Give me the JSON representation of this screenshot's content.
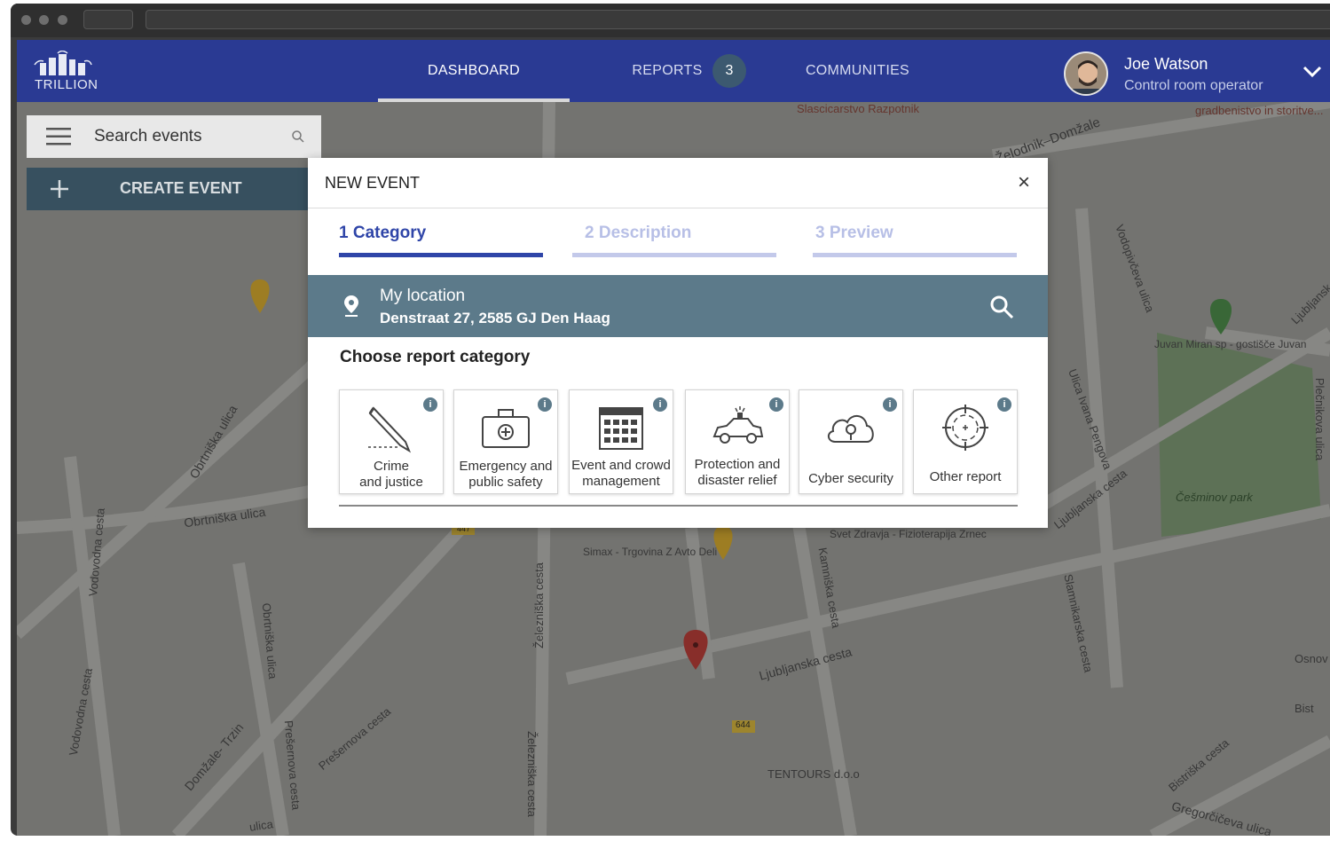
{
  "nav": {
    "logo_text": "TRILLION",
    "items": [
      {
        "label": "DASHBOARD"
      },
      {
        "label": "REPORTS"
      },
      {
        "label": "COMMUNITIES"
      }
    ],
    "reports_badge": "3"
  },
  "user": {
    "name": "Joe Watson",
    "role": "Control room operator"
  },
  "sidebar": {
    "search_placeholder": "Search events",
    "create_label": "CREATE EVENT"
  },
  "map": {
    "labels": [
      "Slascicarstvo Razpotnik",
      "Želodnik–Domžale",
      "gradbenistvo in storitve...",
      "Vodopivčeva ulica",
      "Juvan Miran sp - gostišče Juvan",
      "Plečnikova ulica",
      "Ljubljansk",
      "Ulica Ivana Pengova",
      "Ljubljanska cesta",
      "Češminov park",
      "Obrtniška ulica",
      "Obrtniška ulica",
      "Vodovodna cesta",
      "Vodovodna cesta",
      "Obrtniška ulica",
      "Simax - Trgovina Z Avto Deli",
      "Železniška cesta",
      "Železniška cesta",
      "Kamniška cesta",
      "Svet Zdravja - Fizioterapija Zrnec",
      "Slamnikarska cesta",
      "Ljubljanska cesta",
      "Osnov",
      "Bist",
      "Bistriška cesta",
      "Gregorčičeva ulica",
      "TENTOURS d.o.o",
      "Domžale- Trzin",
      "Prešernova cesta",
      "Prešernova cesta",
      "ulica"
    ],
    "road_numbers": [
      "644",
      "447"
    ]
  },
  "modal": {
    "title": "NEW EVENT",
    "close": "×",
    "steps": [
      {
        "label": "1 Category",
        "active": true
      },
      {
        "label": "2 Description",
        "active": false
      },
      {
        "label": "3 Preview",
        "active": false
      }
    ],
    "location_title": "My location",
    "location_address": "Denstraat 27, 2585 GJ  Den Haag",
    "choose_label": "Choose report category",
    "categories": [
      {
        "line1": "Crime",
        "line2": "and justice",
        "icon": "knife-icon"
      },
      {
        "line1": "Emergency and",
        "line2": "public safety",
        "icon": "first-aid-kit-icon"
      },
      {
        "line1": "Event and crowd",
        "line2": "management",
        "icon": "calendar-icon"
      },
      {
        "line1": "Protection and",
        "line2": "disaster relief",
        "icon": "police-car-icon"
      },
      {
        "line1": "Cyber security",
        "line2": "",
        "icon": "cloud-lock-icon"
      },
      {
        "line1": "Other report",
        "line2": "",
        "icon": "crosshair-icon"
      }
    ],
    "info_glyph": "i"
  },
  "colors": {
    "topbar": "#2a3a93",
    "accent_blue": "#2f45a8",
    "inactive_step": "#c3c9ea",
    "location_bar": "#5c7a8a",
    "create_button": "#37505f"
  }
}
